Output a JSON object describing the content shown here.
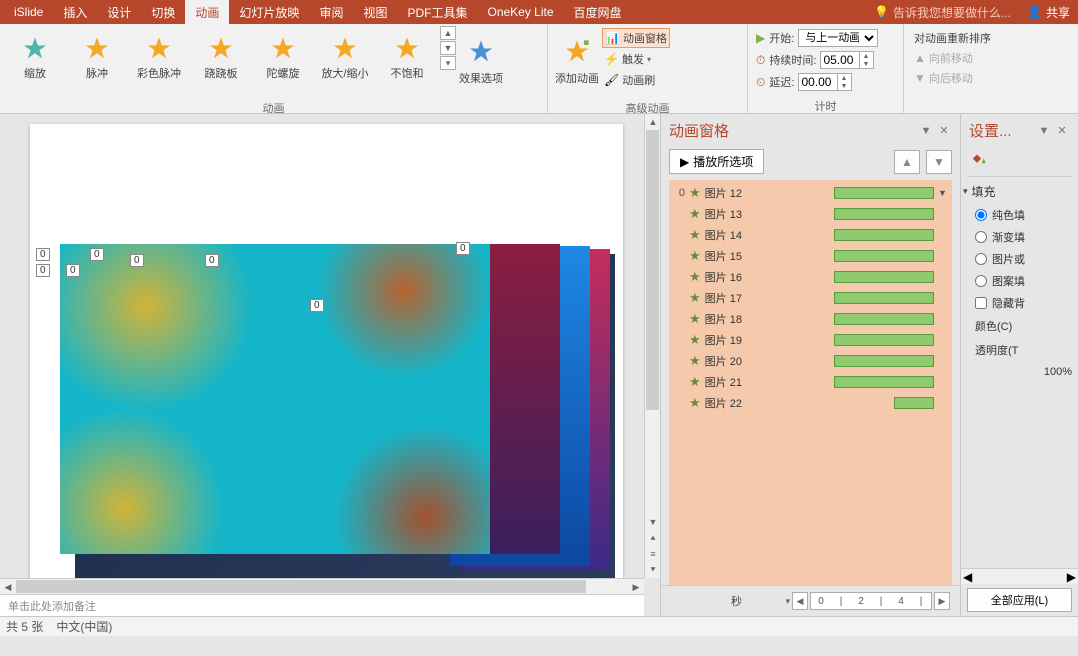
{
  "tabs": {
    "islide": "iSlide",
    "insert": "插入",
    "design": "设计",
    "transitions": "切换",
    "animations": "动画",
    "slideshow": "幻灯片放映",
    "review": "审阅",
    "view": "视图",
    "pdf": "PDF工具集",
    "onekey": "OneKey Lite",
    "baidu": "百度网盘"
  },
  "tell_me": "告诉我您想要做什么...",
  "share": "共享",
  "animations": {
    "shrink": "缩放",
    "pulse": "脉冲",
    "color_pulse": "彩色脉冲",
    "teeter": "跷跷板",
    "spin": "陀螺旋",
    "grow": "放大/缩小",
    "desaturate": "不饱和"
  },
  "group_anim": "动画",
  "effect_options": "效果选项",
  "add_anim": "添加动画",
  "anim_pane_btn": "动画窗格",
  "trigger": "触发",
  "painter": "动画刷",
  "group_advanced": "高级动画",
  "timing": {
    "start_lbl": "开始:",
    "start_val": "与上一动画...",
    "duration_lbl": "持续时间:",
    "duration_val": "05.00",
    "delay_lbl": "延迟:",
    "delay_val": "00.00",
    "group": "计时"
  },
  "reorder": {
    "title": "对动画重新排序",
    "earlier": "向前移动",
    "later": "向后移动"
  },
  "anim_pane": {
    "title": "动画窗格",
    "play": "播放所选项",
    "items": [
      {
        "order": "0",
        "name": "图片 12"
      },
      {
        "order": "",
        "name": "图片 13"
      },
      {
        "order": "",
        "name": "图片 14"
      },
      {
        "order": "",
        "name": "图片 15"
      },
      {
        "order": "",
        "name": "图片 16"
      },
      {
        "order": "",
        "name": "图片 17"
      },
      {
        "order": "",
        "name": "图片 18"
      },
      {
        "order": "",
        "name": "图片 19"
      },
      {
        "order": "",
        "name": "图片 20"
      },
      {
        "order": "",
        "name": "图片 21"
      },
      {
        "order": "",
        "name": "图片 22"
      }
    ],
    "seconds": "秒",
    "tl_nums": [
      "0",
      "2",
      "4"
    ]
  },
  "format_pane": {
    "title": "设置...",
    "fill": "填充",
    "solid": "纯色填",
    "gradient": "渐变填",
    "picture": "图片或",
    "pattern": "图案填",
    "hide": "隐藏背",
    "color": "颜色(C)",
    "transparency": "透明度(T",
    "pct": "100%",
    "applyall": "全部应用(L)"
  },
  "notes_placeholder": "单击此处添加备注",
  "status": {
    "slide": "共 5 张",
    "lang": "中文(中国)"
  },
  "tags": [
    "0",
    "0",
    "0",
    "0",
    "0",
    "0",
    "0",
    "0"
  ]
}
